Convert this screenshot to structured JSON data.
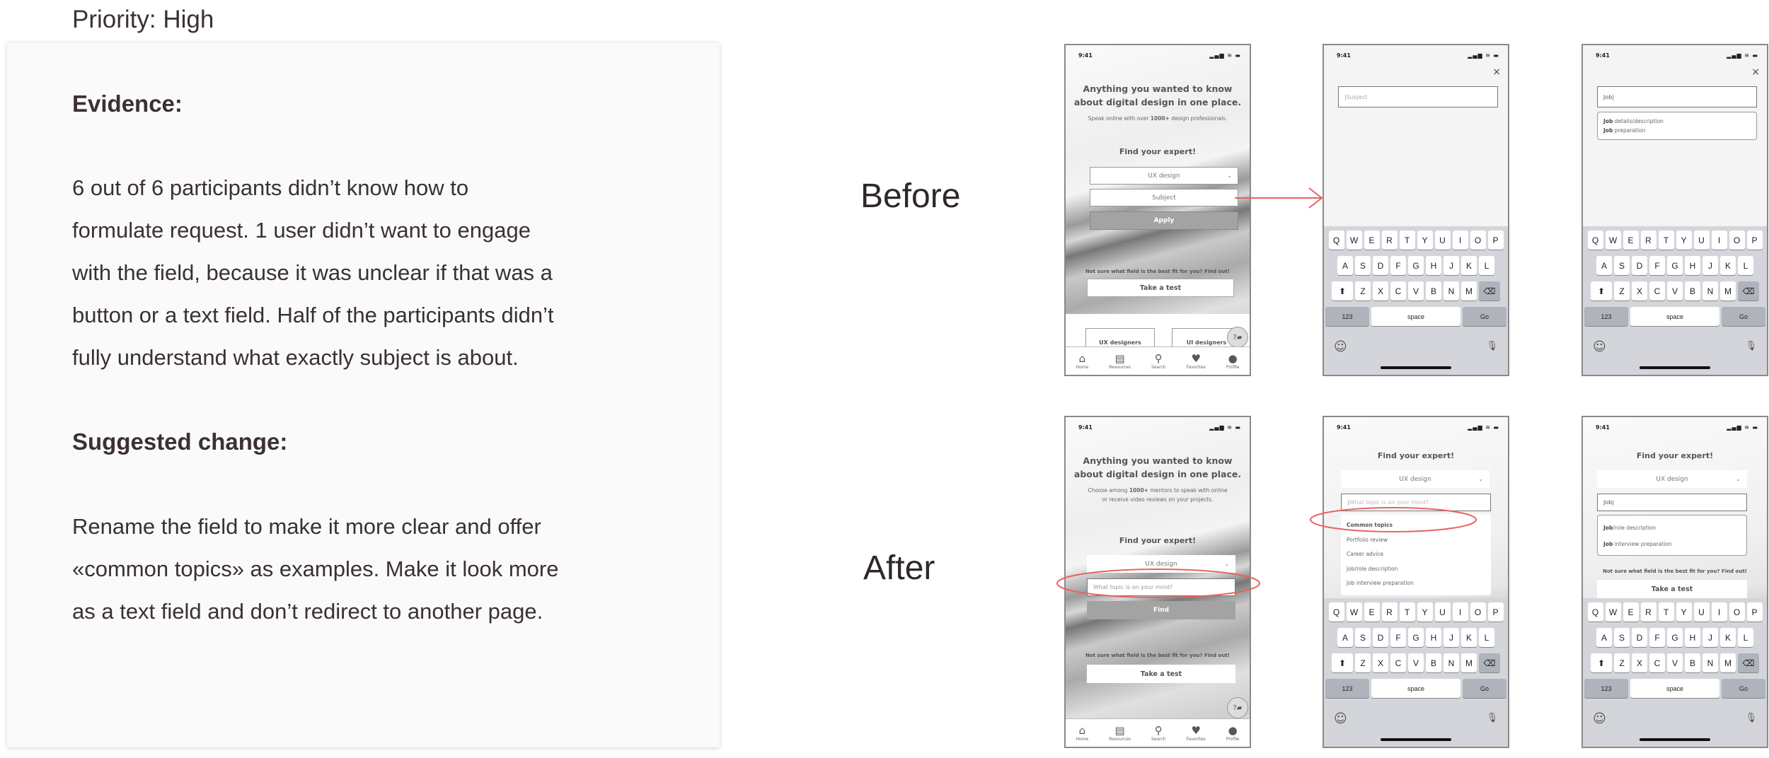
{
  "priority": "Priority: High",
  "evidence": {
    "heading": "Evidence:",
    "lines": [
      "6 out of 6 participants didn’t know how to",
      "formulate request. 1 user didn’t want to engage",
      "with the field, because it was unclear if that was a",
      "button or a text field. Half of the participants didn’t",
      "fully understand what exactly subject is about."
    ]
  },
  "suggested": {
    "heading": "Suggested change:",
    "lines": [
      "Rename the field to make it more clear and offer",
      "«common topics» as examples. Make it look more",
      "as a text field and don’t redirect to another page."
    ]
  },
  "labels": {
    "before": "Before",
    "after": "After"
  },
  "status": {
    "time": "9:41",
    "signal": "▂▄▆ ≋ ▬"
  },
  "annotation_color": "#e8635f",
  "before_home": {
    "title_1": "Anything you wanted to know",
    "title_2": "about digital design in one place.",
    "subtitle_pre": "Speak online with over ",
    "subtitle_bold": "1000+",
    "subtitle_post": " design professionals.",
    "find": "Find your expert!",
    "dropdown": "UX design",
    "subject": "Subject",
    "apply": "Apply",
    "not_sure": "Not sure what field is the best fit for you? Find out!",
    "take_test": "Take a test",
    "cards": [
      "UX designers",
      "UI designers"
    ],
    "chat": "?▰"
  },
  "nav": [
    "Home",
    "Resources",
    "Search",
    "Favorites",
    "Profile"
  ],
  "before_search": {
    "close": "×",
    "placeholder": "Subject"
  },
  "before_typed": {
    "close": "×",
    "value": "Job",
    "suggestions": [
      {
        "bold": "Job",
        "rest": " details/description"
      },
      {
        "bold": "Job",
        "rest": " preparation"
      }
    ]
  },
  "after_home": {
    "title_1": "Anything you wanted to know",
    "title_2": "about digital design in one place.",
    "subtitle_1_pre": "Choose among ",
    "subtitle_1_bold": "1000+",
    "subtitle_1_post": " mentors to speak with online",
    "subtitle_2": "or receive video reviews on your projects.",
    "find": "Find your expert!",
    "dropdown": "UX design",
    "placeholder": "What topic is on your mind?",
    "button": "Find",
    "not_sure": "Not sure what field is the best fit for you? Find out!",
    "take_test": "Take a test",
    "chat": "?▰"
  },
  "after_focus": {
    "find": "Find your expert!",
    "dropdown": "UX design",
    "placeholder": "What topic is on your mind?",
    "list_heading": "Common topics",
    "topics": [
      "Portfolio review",
      "Career advice",
      "Job/role description",
      "Job interview preparation"
    ]
  },
  "after_typed": {
    "find": "Find your expert!",
    "dropdown": "UX design",
    "value": "Job",
    "suggestions": [
      {
        "bold": "Job",
        "rest": "/role description"
      },
      {
        "bold": "Job",
        "rest": " interview preparation"
      }
    ],
    "not_sure": "Not sure what field is the best fit for you? Find out!",
    "take_test": "Take a test"
  },
  "keyboard": {
    "rows": [
      [
        "Q",
        "W",
        "E",
        "R",
        "T",
        "Y",
        "U",
        "I",
        "O",
        "P"
      ],
      [
        "A",
        "S",
        "D",
        "F",
        "G",
        "H",
        "J",
        "K",
        "L"
      ],
      [
        "⬆",
        "Z",
        "X",
        "C",
        "V",
        "B",
        "N",
        "M",
        "⌫"
      ]
    ],
    "numbers": "123",
    "space": "space",
    "go": "Go",
    "emoji": "☺",
    "mic": "🎙"
  }
}
